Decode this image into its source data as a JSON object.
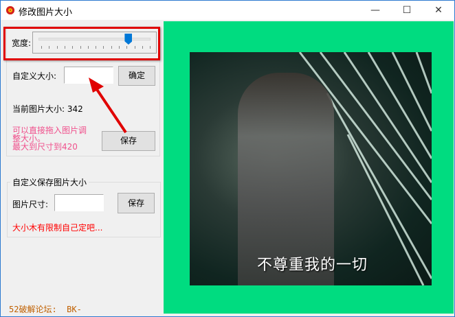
{
  "window": {
    "title": "修改图片大小",
    "minimize": "—",
    "maximize": "☐",
    "close": "✕"
  },
  "width_slider": {
    "label": "宽度:",
    "value_fraction": 0.8
  },
  "custom_size": {
    "label": "自定义大小:",
    "value": "",
    "confirm": "确定"
  },
  "current_size": {
    "label": "当前图片大小:",
    "value": "342"
  },
  "hint": {
    "line1": "可以直接拖入图片调",
    "line2": "整大小。",
    "line3": "最大到尺寸到420"
  },
  "save_button": "保存",
  "save_group": {
    "title": "自定义保存图片大小",
    "size_label": "图片尺寸:",
    "size_value": "",
    "save": "保存",
    "note": "大小木有限制自己定吧..."
  },
  "footer": "52破解论坛:  BK-",
  "preview": {
    "subtitle": "不尊重我的一切",
    "background": "#00dc80"
  },
  "colors": {
    "hint": "#f0508c",
    "note": "#ff0000",
    "footer": "#c06000",
    "accent": "#0078d7"
  }
}
